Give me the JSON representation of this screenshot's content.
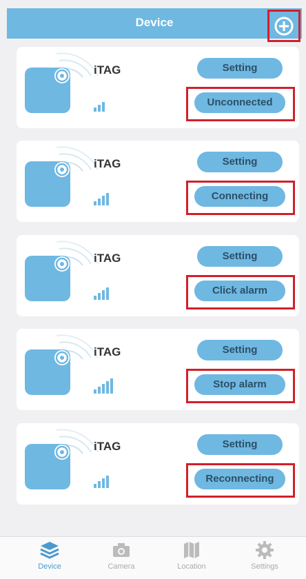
{
  "header": {
    "title": "Device",
    "add_icon": "plus-circle-icon"
  },
  "devices": [
    {
      "name": "iTAG",
      "setting_label": "Setting",
      "action_label": "Unconnected",
      "signal_bars": 3
    },
    {
      "name": "iTAG",
      "setting_label": "Setting",
      "action_label": "Connecting",
      "signal_bars": 4
    },
    {
      "name": "iTAG",
      "setting_label": "Setting",
      "action_label": "Click alarm",
      "signal_bars": 4
    },
    {
      "name": "iTAG",
      "setting_label": "Setting",
      "action_label": "Stop alarm",
      "signal_bars": 5
    },
    {
      "name": "iTAG",
      "setting_label": "Setting",
      "action_label": "Reconnecting",
      "signal_bars": 4
    }
  ],
  "tabbar": {
    "items": [
      {
        "label": "Device",
        "icon": "layers-icon",
        "active": true
      },
      {
        "label": "Camera",
        "icon": "camera-icon",
        "active": false
      },
      {
        "label": "Location",
        "icon": "map-icon",
        "active": false
      },
      {
        "label": "Settings",
        "icon": "gear-icon",
        "active": false
      }
    ]
  },
  "colors": {
    "accent": "#6fb8e2",
    "highlight": "#d0202a",
    "background": "#f0f0f2"
  }
}
